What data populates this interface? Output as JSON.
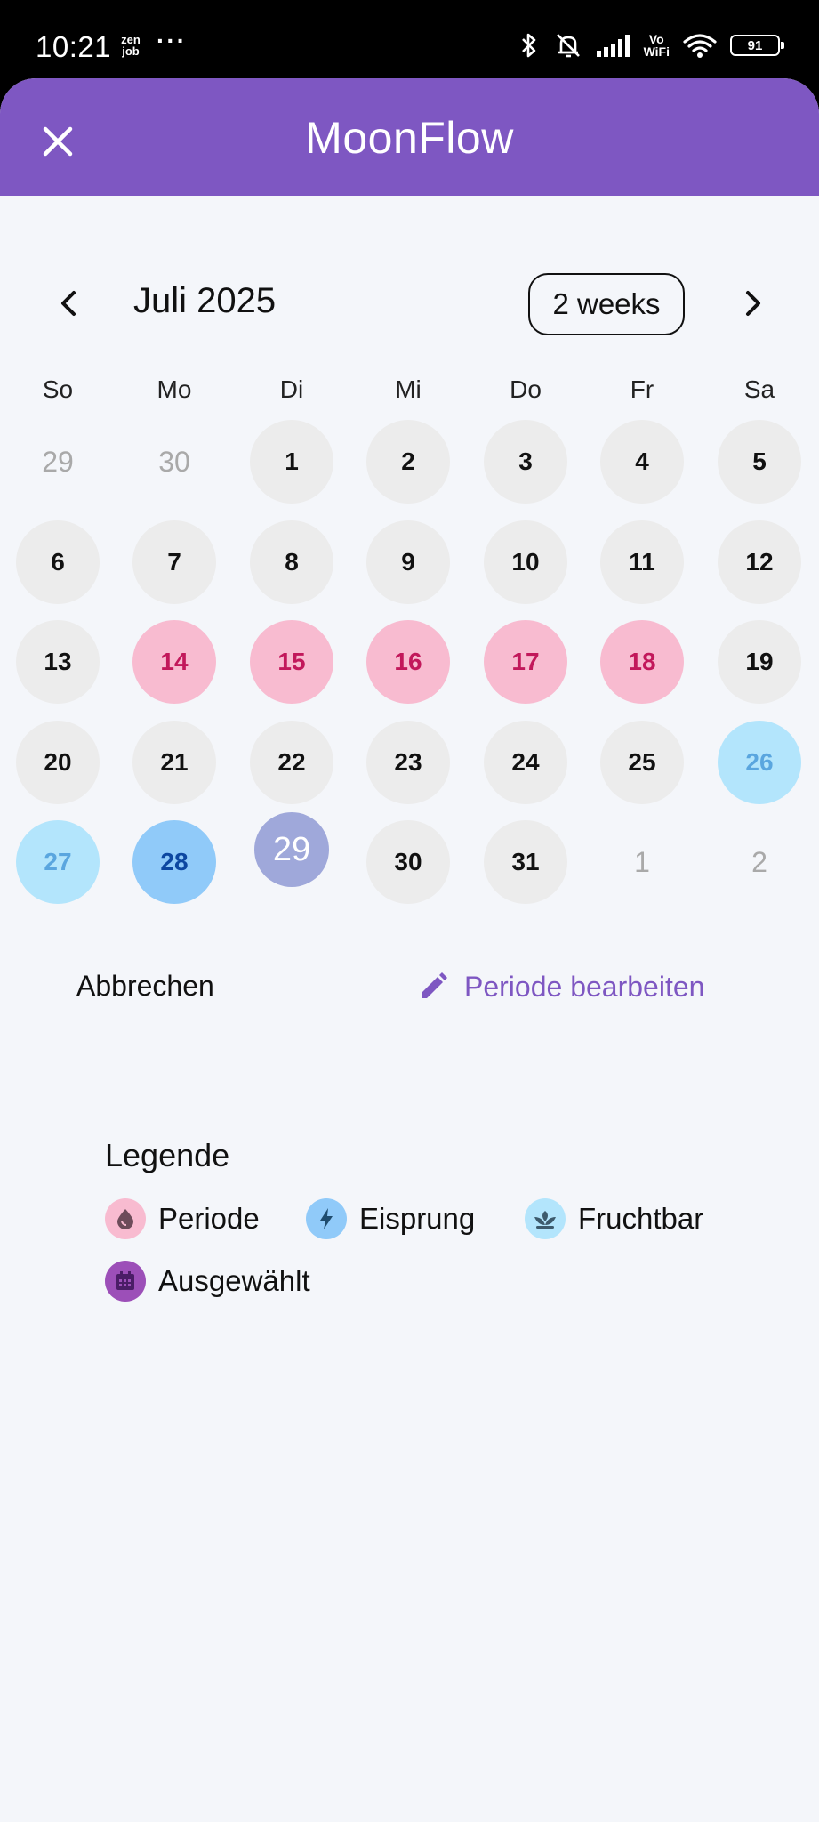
{
  "status_bar": {
    "time": "10:21",
    "app_badge_line1": "zen",
    "app_badge_line2": "job",
    "more": "···",
    "vowifi_line1": "Vo",
    "vowifi_line2": "WiFi",
    "battery": "91",
    "icons": [
      "bluetooth-icon",
      "silent-icon",
      "signal-icon",
      "wifi-icon",
      "battery-icon"
    ]
  },
  "app_bar": {
    "title": "MoonFlow",
    "close_icon": "close-icon",
    "color": "#7e57c2"
  },
  "calendar": {
    "month_label": "Juli 2025",
    "view_toggle": "2 weeks",
    "weekdays": [
      "So",
      "Mo",
      "Di",
      "Mi",
      "Do",
      "Fr",
      "Sa"
    ],
    "weeks": [
      [
        {
          "d": "29",
          "t": "outside"
        },
        {
          "d": "30",
          "t": "outside"
        },
        {
          "d": "1",
          "t": "normal"
        },
        {
          "d": "2",
          "t": "normal"
        },
        {
          "d": "3",
          "t": "normal"
        },
        {
          "d": "4",
          "t": "normal"
        },
        {
          "d": "5",
          "t": "normal"
        }
      ],
      [
        {
          "d": "6",
          "t": "normal"
        },
        {
          "d": "7",
          "t": "normal"
        },
        {
          "d": "8",
          "t": "normal"
        },
        {
          "d": "9",
          "t": "normal"
        },
        {
          "d": "10",
          "t": "normal"
        },
        {
          "d": "11",
          "t": "normal"
        },
        {
          "d": "12",
          "t": "normal"
        }
      ],
      [
        {
          "d": "13",
          "t": "normal"
        },
        {
          "d": "14",
          "t": "period"
        },
        {
          "d": "15",
          "t": "period"
        },
        {
          "d": "16",
          "t": "period"
        },
        {
          "d": "17",
          "t": "period"
        },
        {
          "d": "18",
          "t": "period"
        },
        {
          "d": "19",
          "t": "normal"
        }
      ],
      [
        {
          "d": "20",
          "t": "normal"
        },
        {
          "d": "21",
          "t": "normal"
        },
        {
          "d": "22",
          "t": "normal"
        },
        {
          "d": "23",
          "t": "normal"
        },
        {
          "d": "24",
          "t": "normal"
        },
        {
          "d": "25",
          "t": "normal"
        },
        {
          "d": "26",
          "t": "fertile"
        }
      ],
      [
        {
          "d": "27",
          "t": "fertile"
        },
        {
          "d": "28",
          "t": "ovulation"
        },
        {
          "d": "29",
          "t": "selected"
        },
        {
          "d": "30",
          "t": "normal"
        },
        {
          "d": "31",
          "t": "normal"
        },
        {
          "d": "1",
          "t": "outside"
        },
        {
          "d": "2",
          "t": "outside"
        }
      ]
    ],
    "colors": {
      "period": "#f8bbd0",
      "fertile": "#b3e5fc",
      "ovulation": "#90caf9",
      "selected": "#9fa8da"
    }
  },
  "actions": {
    "cancel": "Abbrechen",
    "edit_period": "Periode bearbeiten",
    "edit_icon": "pencil-icon"
  },
  "legend": {
    "title": "Legende",
    "items": [
      {
        "label": "Periode",
        "icon": "drop-icon",
        "color": "#f8bbd0"
      },
      {
        "label": "Eisprung",
        "icon": "bolt-icon",
        "color": "#90caf9"
      },
      {
        "label": "Fruchtbar",
        "icon": "sprout-icon",
        "color": "#b3e5fc"
      },
      {
        "label": "Ausgewählt",
        "icon": "calendar-icon",
        "color": "#9c4fb8"
      }
    ]
  }
}
